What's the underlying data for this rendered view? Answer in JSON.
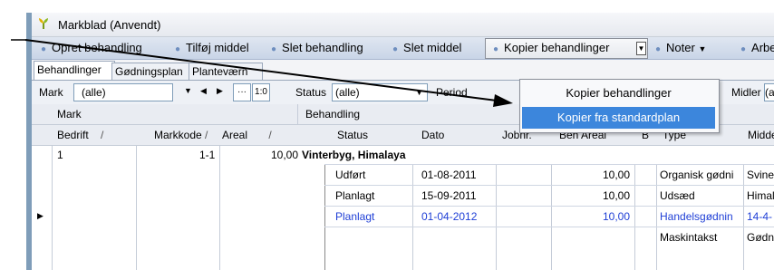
{
  "window": {
    "title": "Markblad (Anvendt)"
  },
  "toolbar": {
    "opret": "Opret behandling",
    "tilfoj": "Tilføj middel",
    "slet_behandling": "Slet behandling",
    "slet_middel": "Slet middel",
    "kopier": "Kopier behandlinger",
    "noter": "Noter",
    "arbej": "Arbej"
  },
  "dropdown_menu": {
    "items": [
      "Kopier behandlinger",
      "Kopier fra standardplan"
    ],
    "selected_index": 1
  },
  "tabs": [
    "Behandlinger",
    "Gødningsplan",
    "Planteværn"
  ],
  "filters": {
    "mark_label": "Mark",
    "mark_value": "(alle)",
    "range_btn": "1:0",
    "status_label": "Status",
    "status_value": "(alle)",
    "period_label": "Period",
    "midler_label": "Midler",
    "midler_value": "(a"
  },
  "grid": {
    "group_headers": {
      "mark": "Mark",
      "behandling": "Behandling"
    },
    "columns": {
      "bedrift": "Bedrift",
      "markkode": "Markkode",
      "areal": "Areal",
      "status": "Status",
      "dato": "Dato",
      "jobnr": "Jobnr.",
      "beh_areal": "Beh Areal",
      "b": "B",
      "type": "Type",
      "midde": "Midde"
    },
    "mark_row": {
      "bedrift": "1",
      "markkode": "1-1",
      "areal": "10,00",
      "crop": "Vinterbyg, Himalaya"
    },
    "rows": [
      {
        "status": "Udført",
        "dato": "01-08-2011",
        "beh_areal": "10,00",
        "type": "Organisk gødni",
        "midde": "Svine"
      },
      {
        "status": "Planlagt",
        "dato": "15-09-2011",
        "beh_areal": "10,00",
        "type": "Udsæd",
        "midde": "Himala"
      },
      {
        "status": "Planlagt",
        "dato": "01-04-2012",
        "beh_areal": "10,00",
        "type": "Handelsgødnin",
        "midde": "14-4-"
      },
      {
        "status": "",
        "dato": "",
        "beh_areal": "",
        "type": "Maskintakst",
        "midde": "Gødni"
      }
    ]
  },
  "colors": {
    "accent": "#3c86dc",
    "link_blue": "#1f3fd6",
    "toolbar": "#c9d5e7"
  }
}
